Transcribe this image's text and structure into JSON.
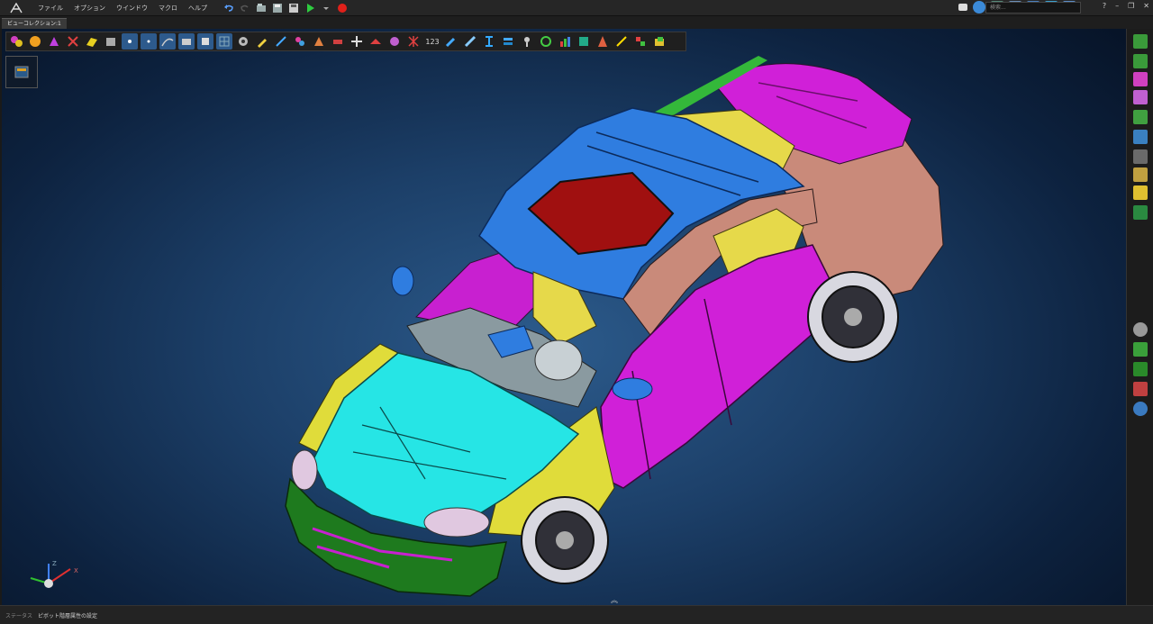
{
  "app": {
    "menus": [
      "ファイル",
      "オプション",
      "ウインドウ",
      "マクロ",
      "ヘルプ"
    ],
    "search_placeholder": "検索..."
  },
  "tabs": [
    {
      "label": "ビューコレクション:1"
    }
  ],
  "toolbar": {
    "counter_label": "123"
  },
  "status": {
    "label": "ステータス",
    "text": "ピボット階層属性の設定"
  },
  "axis": {
    "z": "Z",
    "x": "X"
  },
  "colors": {
    "accent": "#2d5a8c",
    "background_center": "#2c5b8c",
    "background_edge": "#071428",
    "roof": "#2f7de0",
    "hood": "#26e5e5",
    "door": "#d020d8",
    "fender": "#e0dc3a",
    "bumper": "#1e7a1e",
    "rear_panel": "#c98a7a"
  }
}
